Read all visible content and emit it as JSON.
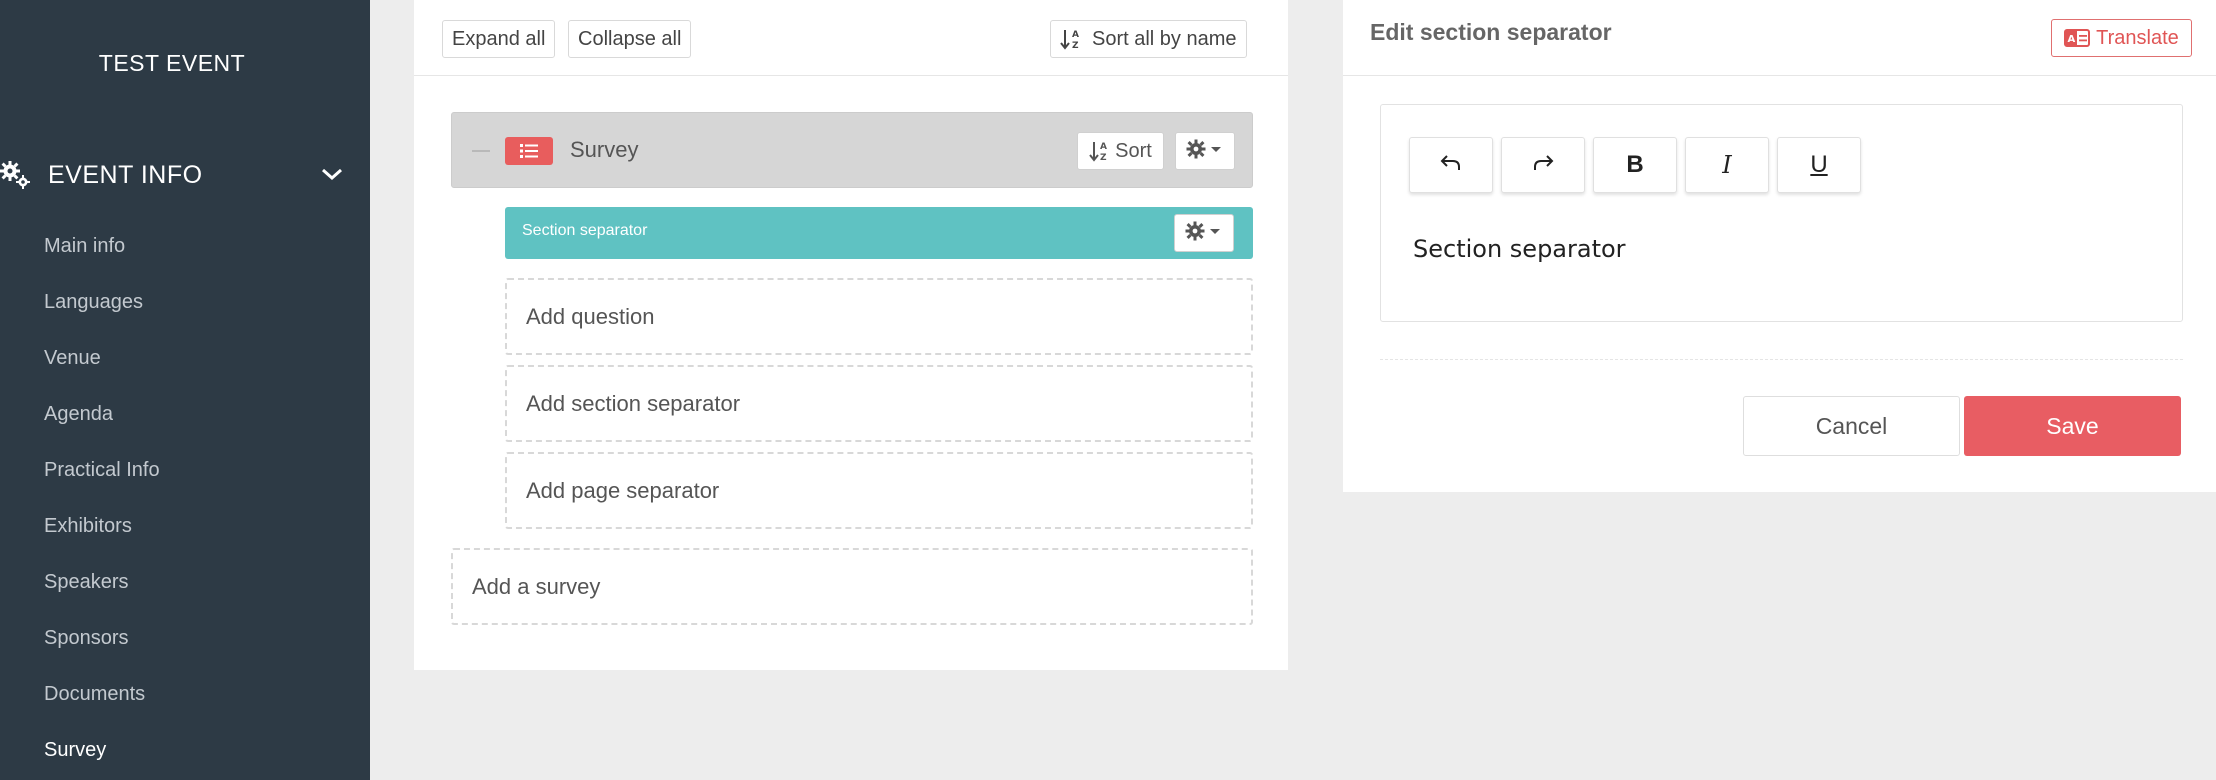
{
  "sidebar": {
    "event_title": "TEST EVENT",
    "section_label": "EVENT INFO",
    "items": [
      {
        "label": "Main info"
      },
      {
        "label": "Languages"
      },
      {
        "label": "Venue"
      },
      {
        "label": "Agenda"
      },
      {
        "label": "Practical Info"
      },
      {
        "label": "Exhibitors"
      },
      {
        "label": "Speakers"
      },
      {
        "label": "Sponsors"
      },
      {
        "label": "Documents"
      },
      {
        "label": "Survey",
        "active": true
      }
    ]
  },
  "toolbar": {
    "expand_all": "Expand all",
    "collapse_all": "Collapse all",
    "sort_all": "Sort all by name"
  },
  "survey": {
    "title": "Survey",
    "sort_label": "Sort",
    "section_separator": "Section separator",
    "add_question": "Add question",
    "add_section_separator": "Add section separator",
    "add_page_separator": "Add page separator",
    "add_survey": "Add a survey"
  },
  "editor": {
    "title": "Edit section separator",
    "translate": "Translate",
    "bold": "B",
    "italic": "I",
    "underline": "U",
    "content": "Section separator",
    "cancel": "Cancel",
    "save": "Save"
  },
  "colors": {
    "sidebar_bg": "#2d3a45",
    "accent_red": "#e85d63",
    "separator_teal": "#5fc2c2"
  }
}
